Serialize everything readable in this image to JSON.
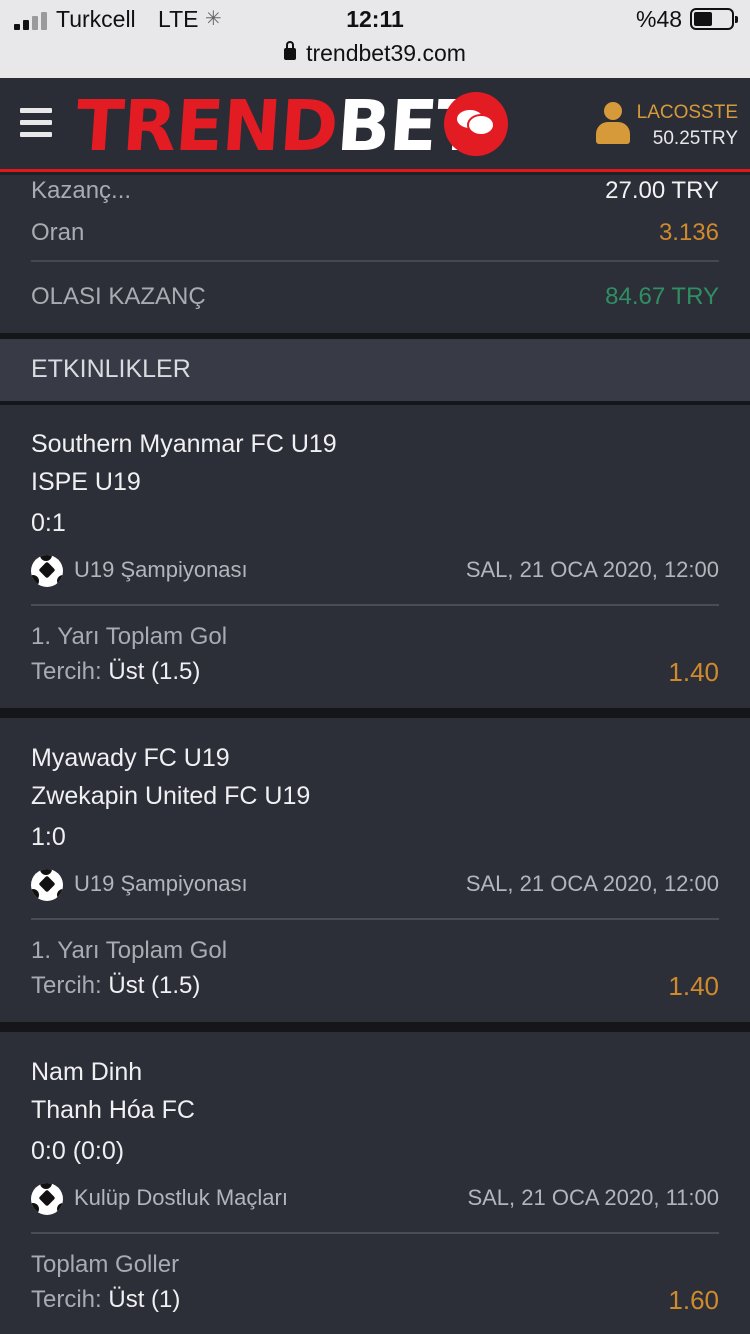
{
  "status_bar": {
    "carrier": "Turkcell",
    "network": "LTE",
    "time": "12:11",
    "battery": "%48",
    "url": "trendbet39.com"
  },
  "header": {
    "logo_part1": "TREND",
    "logo_part2": "BET",
    "username": "LACOSSTE",
    "balance": "50.25TRY"
  },
  "summary": {
    "stake_label": "Kazanç...",
    "stake_value": "27.00 TRY",
    "odds_label": "Oran",
    "odds_value": "3.136",
    "potential_label": "OLASI KAZANÇ",
    "potential_value": "84.67 TRY"
  },
  "section_title": "ETKINLIKLER",
  "events": [
    {
      "home": "Southern Myanmar FC U19",
      "away": "ISPE U19",
      "score": "0:1",
      "league": "U19 Şampiyonası",
      "date": "SAL, 21 OCA 2020, 12:00",
      "market": "1. Yarı Toplam Gol",
      "pick_label": "Tercih:",
      "pick_value": "Üst (1.5)",
      "odds": "1.40"
    },
    {
      "home": "Myawady FC U19",
      "away": "Zwekapin United FC U19",
      "score": "1:0",
      "league": "U19 Şampiyonası",
      "date": "SAL, 21 OCA 2020, 12:00",
      "market": "1. Yarı Toplam Gol",
      "pick_label": "Tercih:",
      "pick_value": "Üst (1.5)",
      "odds": "1.40"
    },
    {
      "home": "Nam Dinh",
      "away": "Thanh Hóa FC",
      "score": "0:0 (0:0)",
      "league": "Kulüp Dostluk Maçları",
      "date": "SAL, 21 OCA 2020, 11:00",
      "market": "Toplam Goller",
      "pick_label": "Tercih:",
      "pick_value": "Üst (1)",
      "odds": "1.60"
    }
  ]
}
